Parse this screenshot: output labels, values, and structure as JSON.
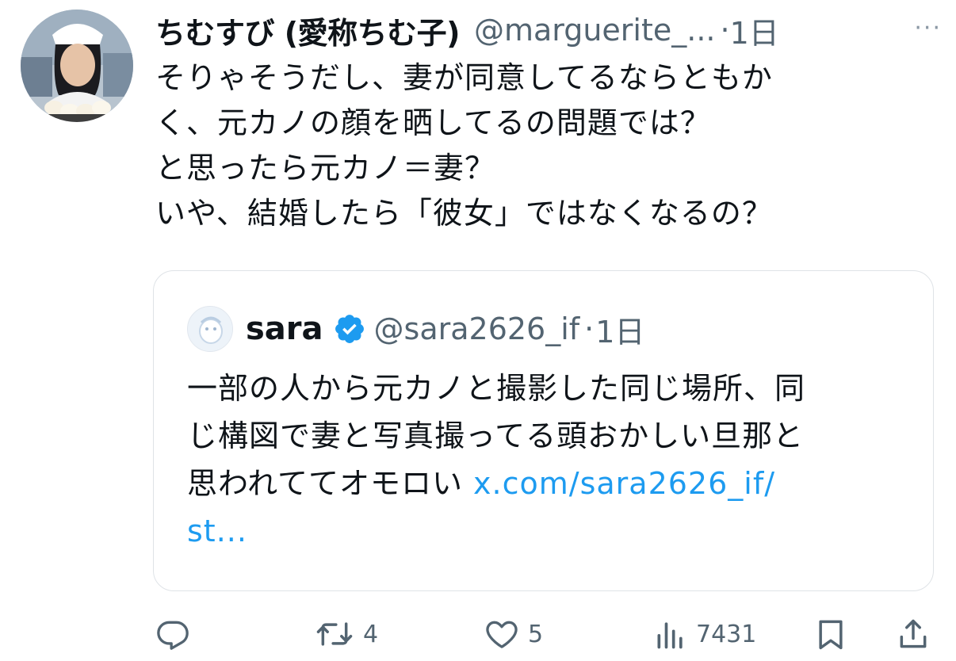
{
  "tweet": {
    "display_name": "ちむすび (愛称ちむ子)",
    "handle": "@marguerite_...",
    "separator": "·",
    "time": "1日",
    "more": "···",
    "lines": [
      "そりゃそうだし、妻が同意してるならともか",
      "く、元カノの顔を晒してるの問題では？",
      "と思ったら元カノ＝妻？",
      "いや、結婚したら「彼女」ではなくなるの？"
    ]
  },
  "quote": {
    "name": "sara",
    "handle": "@sara2626_if",
    "separator": "·",
    "time": "1日",
    "lines": [
      "一部の人から元カノと撮影した同じ場所、同",
      "じ構図で妻と写真撮ってる頭おかしい旦那と"
    ],
    "line3_text": "思われててオモロい ",
    "link_part1": "x.com/sara2626_if/",
    "link_part2": "st..."
  },
  "actions": {
    "reply_icon": "reply-icon",
    "retweet_icon": "retweet-icon",
    "retweet_count": "4",
    "like_icon": "heart-icon",
    "like_count": "5",
    "views_icon": "views-icon",
    "views_count": "7431",
    "bookmark_icon": "bookmark-icon",
    "share_icon": "share-icon"
  },
  "colors": {
    "text": "#0f1419",
    "secondary": "#536471",
    "link": "#1d9bf0",
    "verified": "#1d9bf0",
    "border": "#dfe3e7"
  }
}
